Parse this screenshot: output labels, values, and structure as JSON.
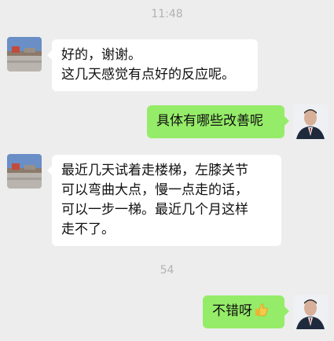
{
  "timestamps": [
    "11:48",
    "54"
  ],
  "messages": [
    {
      "side": "left",
      "lines": [
        "好的，谢谢。",
        "这几天感觉有点好的反应呢。"
      ]
    },
    {
      "side": "right",
      "lines": [
        "具体有哪些改善呢"
      ]
    },
    {
      "side": "left",
      "lines": [
        "最近几天试着走楼梯，左膝关节",
        "可以弯曲大点，慢一点走的话，",
        "可以一步一梯。最近几个月这样",
        "走不了。"
      ]
    },
    {
      "side": "right",
      "lines": [
        "不错呀"
      ],
      "emoji": "thumbs-up"
    }
  ],
  "colors": {
    "background": "#ededed",
    "bubble_left": "#ffffff",
    "bubble_right": "#95ec69",
    "timestamp": "#b2b2b2"
  }
}
